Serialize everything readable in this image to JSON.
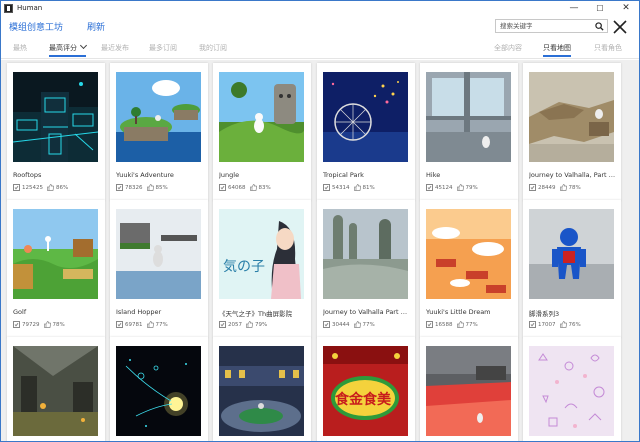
{
  "window": {
    "title": "Human",
    "minimize": "—",
    "maximize": "☐",
    "close": "✕"
  },
  "header": {
    "title": "模组创意工坊",
    "refresh": "刷新",
    "search_placeholder": "搜索关键字"
  },
  "tabs_left": [
    {
      "label": "最热",
      "active": false
    },
    {
      "label": "最高评分",
      "active": true
    },
    {
      "label": "最近发布",
      "active": false
    },
    {
      "label": "最多订阅",
      "active": false
    },
    {
      "label": "我的订阅",
      "active": false
    }
  ],
  "tabs_right": [
    {
      "label": "全部内容",
      "active": false
    },
    {
      "label": "只看地图",
      "active": true
    },
    {
      "label": "只看角色",
      "active": false
    }
  ],
  "cards": [
    {
      "title": "Rooftops",
      "subs": "125425",
      "rating": "86%"
    },
    {
      "title": "Yuuki's Adventure",
      "subs": "78326",
      "rating": "85%"
    },
    {
      "title": "Jungle",
      "subs": "64068",
      "rating": "83%"
    },
    {
      "title": "Tropical Park",
      "subs": "54314",
      "rating": "81%"
    },
    {
      "title": "Hike",
      "subs": "45124",
      "rating": "79%"
    },
    {
      "title": "Journey to Valhalla, Part 6 (Jot...",
      "subs": "28449",
      "rating": "78%"
    },
    {
      "title": "Golf",
      "subs": "79729",
      "rating": "78%"
    },
    {
      "title": "Island Hopper",
      "subs": "69781",
      "rating": "77%"
    },
    {
      "title": "《天气之子》Th曲屏影院",
      "subs": "2057",
      "rating": "79%"
    },
    {
      "title": "Journey to Valhalla Part 1 [Mi...",
      "subs": "30444",
      "rating": "77%"
    },
    {
      "title": "Yuuki's Little Dream",
      "subs": "16588",
      "rating": "77%"
    },
    {
      "title": "脚滑系列3",
      "subs": "17007",
      "rating": "76%"
    },
    {
      "title": "",
      "subs": "",
      "rating": ""
    },
    {
      "title": "",
      "subs": "",
      "rating": ""
    },
    {
      "title": "",
      "subs": "",
      "rating": ""
    },
    {
      "title": "",
      "subs": "",
      "rating": ""
    },
    {
      "title": "",
      "subs": "",
      "rating": ""
    },
    {
      "title": "",
      "subs": "",
      "rating": ""
    }
  ],
  "thumb_text": {
    "weathering_kanji": "気の子",
    "food_logo": "食金食美"
  },
  "colors": {
    "accent": "#2b6fd6",
    "background": "#efefef"
  }
}
